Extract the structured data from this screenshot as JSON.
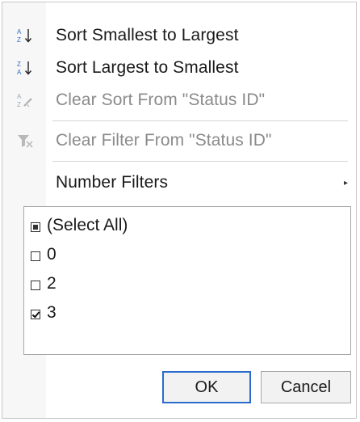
{
  "menu": {
    "sort_asc_label": "Sort Smallest to Largest",
    "sort_desc_label": "Sort Largest to Smallest",
    "clear_sort_label": "Clear Sort From \"Status ID\"",
    "clear_filter_label": "Clear Filter From \"Status ID\"",
    "number_filters_label": "Number Filters"
  },
  "filter_list": {
    "items": [
      {
        "label": "(Select All)",
        "state": "indeterminate"
      },
      {
        "label": "0",
        "state": "unchecked"
      },
      {
        "label": "2",
        "state": "unchecked"
      },
      {
        "label": "3",
        "state": "checked"
      }
    ]
  },
  "buttons": {
    "ok_label": "OK",
    "cancel_label": "Cancel"
  },
  "icons": {
    "sort_asc": "sort-ascending-icon",
    "sort_desc": "sort-descending-icon",
    "clear_sort": "clear-sort-icon",
    "clear_filter": "clear-filter-icon",
    "submenu_arrow": "submenu-arrow-icon"
  },
  "colors": {
    "accent": "#2a6ccb",
    "disabled_text": "#8a8a8a"
  }
}
